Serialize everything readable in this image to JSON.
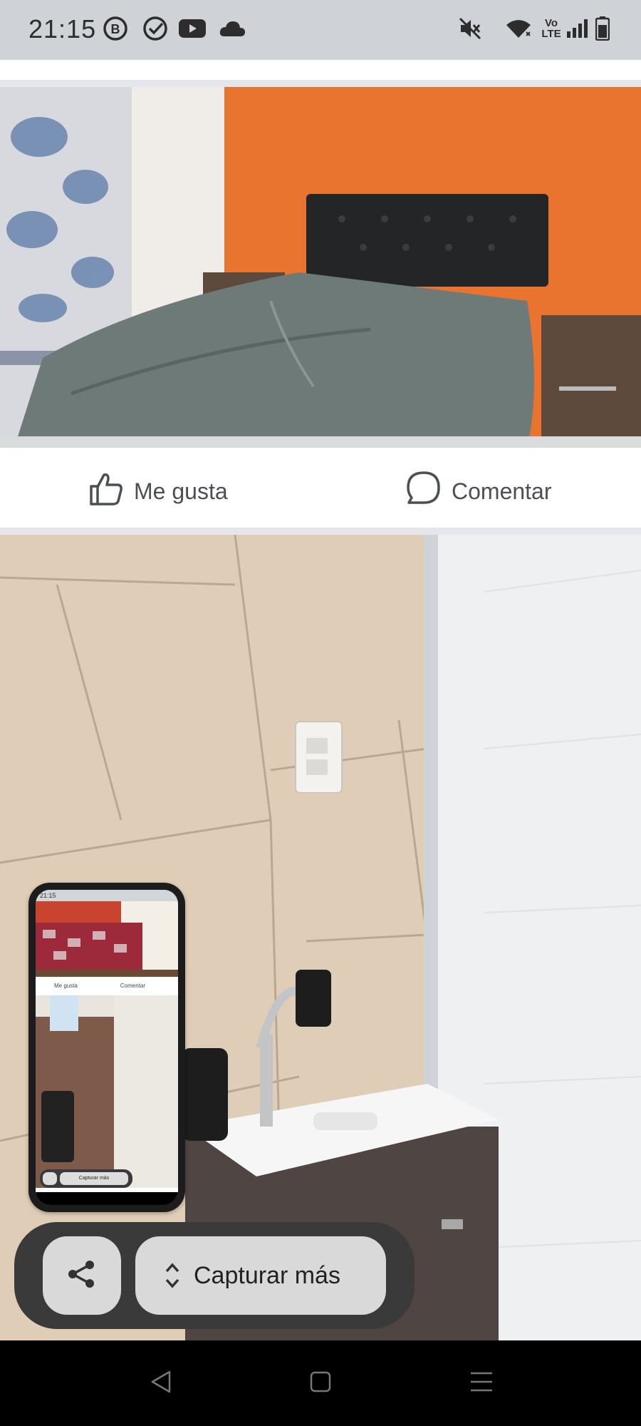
{
  "status_bar": {
    "time": "21:15",
    "left_icons": [
      "b-badge-icon",
      "check-circle-icon",
      "youtube-icon",
      "cloud-icon"
    ],
    "right_icons": [
      "mute-icon",
      "wifi-icon",
      "volte-icon",
      "signal-icon",
      "battery-icon"
    ]
  },
  "post_actions": {
    "like_label": "Me gusta",
    "comment_label": "Comentar"
  },
  "screenshot_toolbar": {
    "capture_more_label": "Capturar más"
  },
  "mini_preview": {
    "time": "21:15",
    "like_label": "Me gusta",
    "comment_label": "Comentar",
    "capture_more_label": "Capturar más"
  },
  "colors": {
    "status_bar_bg": "#cfd3d8",
    "action_text": "#4b4f56",
    "toolbar_bg": "#3a3a3a",
    "toolbar_button_bg": "#d9d9d9",
    "nav_bar_bg": "#000000"
  }
}
